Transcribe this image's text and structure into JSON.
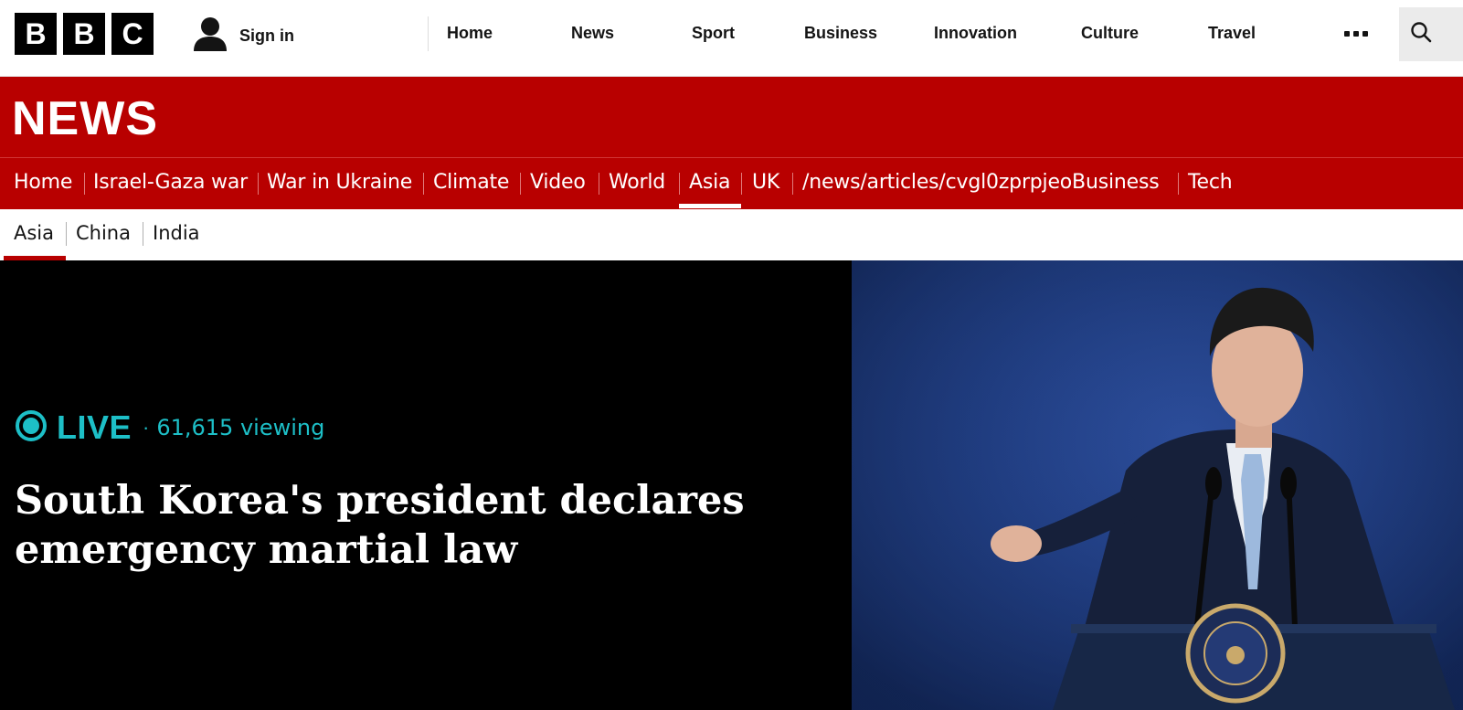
{
  "brand": {
    "letters": [
      "B",
      "B",
      "C"
    ]
  },
  "account": {
    "sign_in_label": "Sign in"
  },
  "top_nav": {
    "items": [
      "Home",
      "News",
      "Sport",
      "Business",
      "Innovation",
      "Culture",
      "Travel"
    ]
  },
  "section": {
    "title": "NEWS"
  },
  "section_nav": {
    "items": [
      "Home",
      "Israel-Gaza war",
      "War in Ukraine",
      "Climate",
      "Video",
      "World",
      "Asia",
      "UK",
      "/news/articles/cvgl0zprpjeoBusiness",
      "Tech"
    ],
    "active": "Asia"
  },
  "sub_nav": {
    "items": [
      "Asia",
      "China",
      "India"
    ],
    "active": "Asia"
  },
  "hero": {
    "live_label": "LIVE",
    "separator": "·",
    "viewers": "61,615 viewing",
    "headline": "South Korea's president declares emergency martial law",
    "image_icon": "press-photo-president-at-podium"
  },
  "colors": {
    "brand_red": "#b80000",
    "live_teal": "#1dbfc7",
    "hero_bg": "#000000",
    "photo_blue": "#1f3c80"
  },
  "icons": {
    "account": "user-icon",
    "more": "more-dots-icon",
    "search": "search-icon",
    "live": "live-ring-icon"
  }
}
